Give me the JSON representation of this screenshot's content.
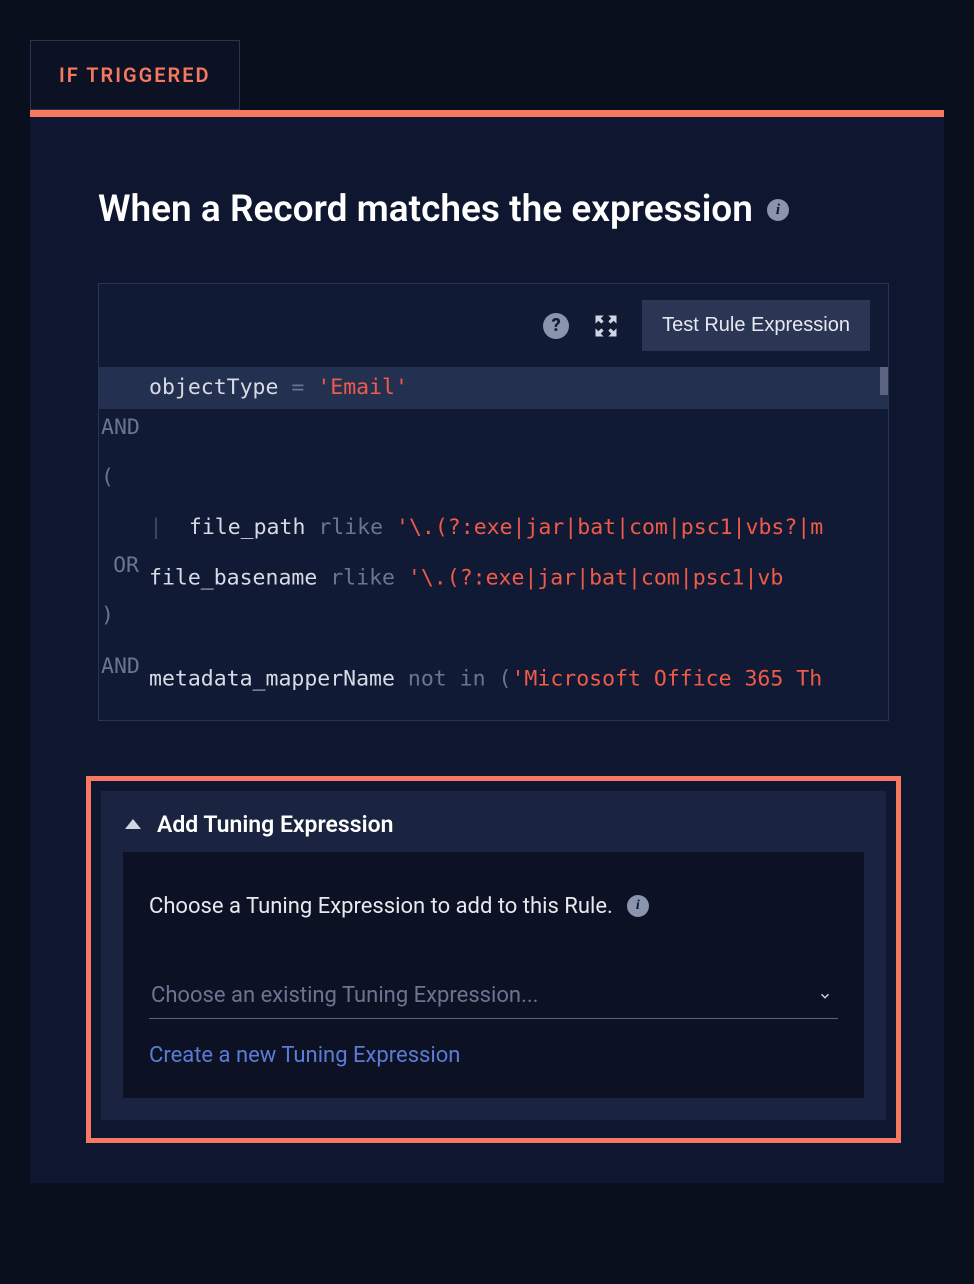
{
  "tab": {
    "label": "IF TRIGGERED"
  },
  "heading": {
    "text": "When a Record matches the expression"
  },
  "toolbar": {
    "test_label": "Test Rule Expression"
  },
  "code": {
    "line1_id": "objectType",
    "line1_op": "=",
    "line1_str": "'Email'",
    "and": "AND",
    "or": "OR",
    "lparen": "(",
    "rparen": ")",
    "line3_id": "file_path",
    "line3_kw": "rlike",
    "line3_str": "'\\.(?:exe|jar|bat|com|psc1|vbs?|m",
    "line4_id": "file_basename",
    "line4_kw": "rlike",
    "line4_str": "'\\.(?:exe|jar|bat|com|psc1|vb",
    "line6_id": "metadata_mapperName",
    "line6_kw": "not in",
    "line6_paren": "(",
    "line6_str": "'Microsoft Office 365 Th"
  },
  "tuning": {
    "header": "Add Tuning Expression",
    "choose_text": "Choose a Tuning Expression to add to this Rule.",
    "select_placeholder": "Choose an existing Tuning Expression...",
    "create_link": "Create a new Tuning Expression"
  }
}
